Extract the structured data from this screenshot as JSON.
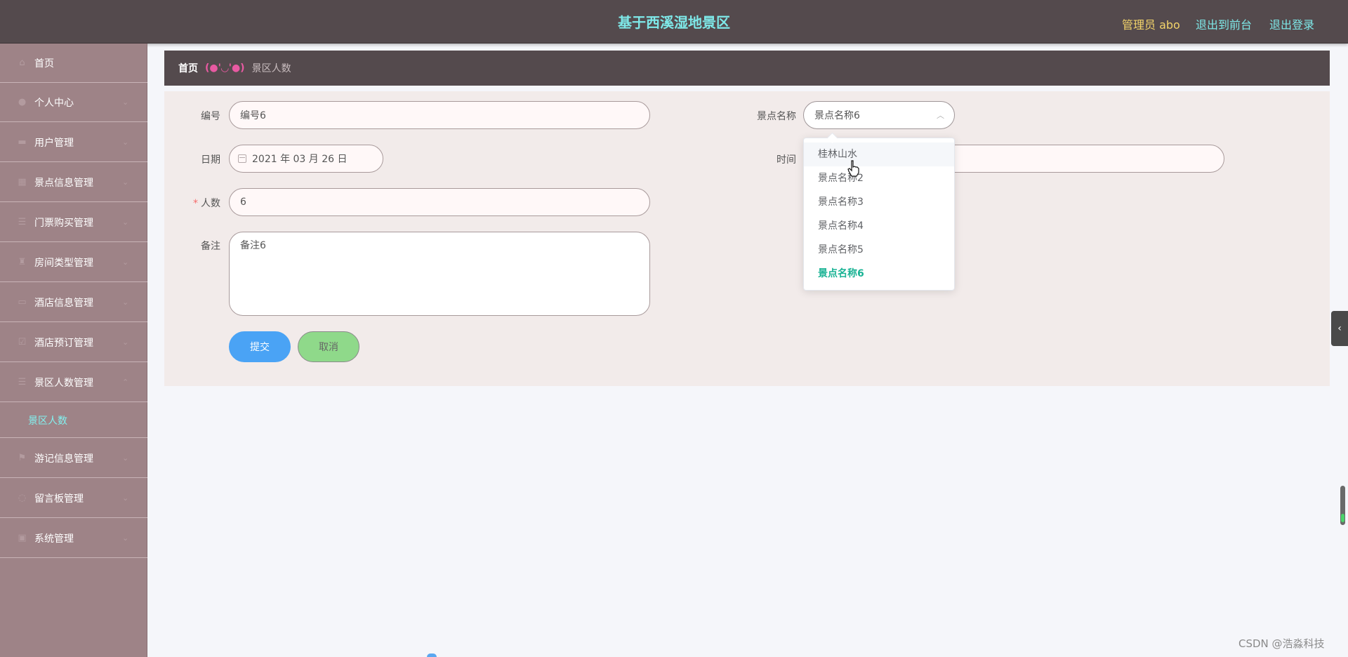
{
  "header": {
    "title": "基于西溪湿地景区",
    "admin_label": "管理员 abo",
    "link_front": "退出到前台",
    "link_logout": "退出登录"
  },
  "sidebar": {
    "items": [
      {
        "label": "首页",
        "icon": "home-icon",
        "has_arrow": false
      },
      {
        "label": "个人中心",
        "icon": "user-icon",
        "has_arrow": true
      },
      {
        "label": "用户管理",
        "icon": "folder-icon",
        "has_arrow": true
      },
      {
        "label": "景点信息管理",
        "icon": "grid-icon",
        "has_arrow": true
      },
      {
        "label": "门票购买管理",
        "icon": "list-icon",
        "has_arrow": true
      },
      {
        "label": "房间类型管理",
        "icon": "trophy-icon",
        "has_arrow": true
      },
      {
        "label": "酒店信息管理",
        "icon": "hotel-icon",
        "has_arrow": true
      },
      {
        "label": "酒店预订管理",
        "icon": "check-icon",
        "has_arrow": true
      },
      {
        "label": "景区人数管理",
        "icon": "menu-icon",
        "has_arrow": true
      },
      {
        "label": "游记信息管理",
        "icon": "flag-icon",
        "has_arrow": true
      },
      {
        "label": "留言板管理",
        "icon": "chat-icon",
        "has_arrow": true
      },
      {
        "label": "系统管理",
        "icon": "system-icon",
        "has_arrow": true
      }
    ],
    "subitem_active": "景区人数"
  },
  "breadcrumb": {
    "home": "首页",
    "separator": "(●'◡'●)",
    "current": "景区人数"
  },
  "form": {
    "number_label": "编号",
    "number_value": "编号6",
    "date_label": "日期",
    "date_value": "2021 年 03 月 26 日",
    "count_label": "人数",
    "count_required": "*",
    "count_value": "6",
    "remark_label": "备注",
    "remark_value": "备注6",
    "spot_label": "景点名称",
    "spot_value": "景点名称6",
    "time_label": "时间",
    "time_value": "",
    "submit_label": "提交",
    "cancel_label": "取消"
  },
  "dropdown": {
    "options": [
      "桂林山水",
      "景点名称2",
      "景点名称3",
      "景点名称4",
      "景点名称5",
      "景点名称6"
    ],
    "hovered_index": 0,
    "selected_index": 5
  },
  "right_toggle_icon": "chevron-left-icon",
  "watermark": "CSDN @浩淼科技",
  "colors": {
    "header_bg": "#544a4d",
    "title": "#7ee8e8",
    "admin": "#f3d46a",
    "sidebar_bg": "#9e8387",
    "submenu_active": "#83f1ef",
    "submit": "#4aa3f5",
    "cancel": "#8fd98a",
    "selected_option": "#1ab394"
  }
}
